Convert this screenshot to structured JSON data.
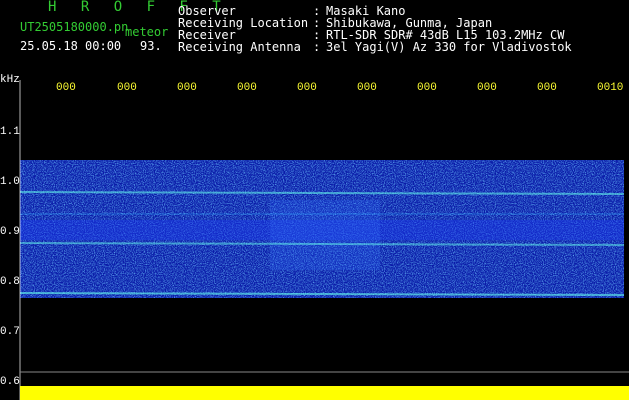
{
  "header": {
    "app_title": "H R O F F T",
    "file_name": "UT2505180000.pn",
    "meteor_label": "meteor",
    "datetime": "25.05.18 00:00",
    "count": "93.",
    "fields": [
      {
        "label": "Observer",
        "value": "Masaki Kano"
      },
      {
        "label": "Receiving Location",
        "value": "Shibukawa, Gunma, Japan"
      },
      {
        "label": "Receiver",
        "value": "RTL-SDR SDR# 43dB L15 103.2MHz CW"
      },
      {
        "label": "Receiving Antenna",
        "value": "3el Yagi(V) Az 330 for Vladivostok"
      }
    ]
  },
  "axis": {
    "unit": "kHz",
    "y_ticks": [
      "1.1",
      "1.0",
      "0.9",
      "0.8",
      "0.7",
      "0.6"
    ],
    "x_ticks": [
      "000",
      "000",
      "000",
      "000",
      "000",
      "000",
      "000",
      "000",
      "000",
      "0010"
    ]
  },
  "colors": {
    "header_green": "#33cc33",
    "header_white": "#ffffff",
    "tick_yellow": "#ffff33",
    "background": "#000000",
    "spectrum_blue": "#1a2fd6",
    "signal_cyan": "#66ffee",
    "strip_yellow": "#ffff00"
  }
}
